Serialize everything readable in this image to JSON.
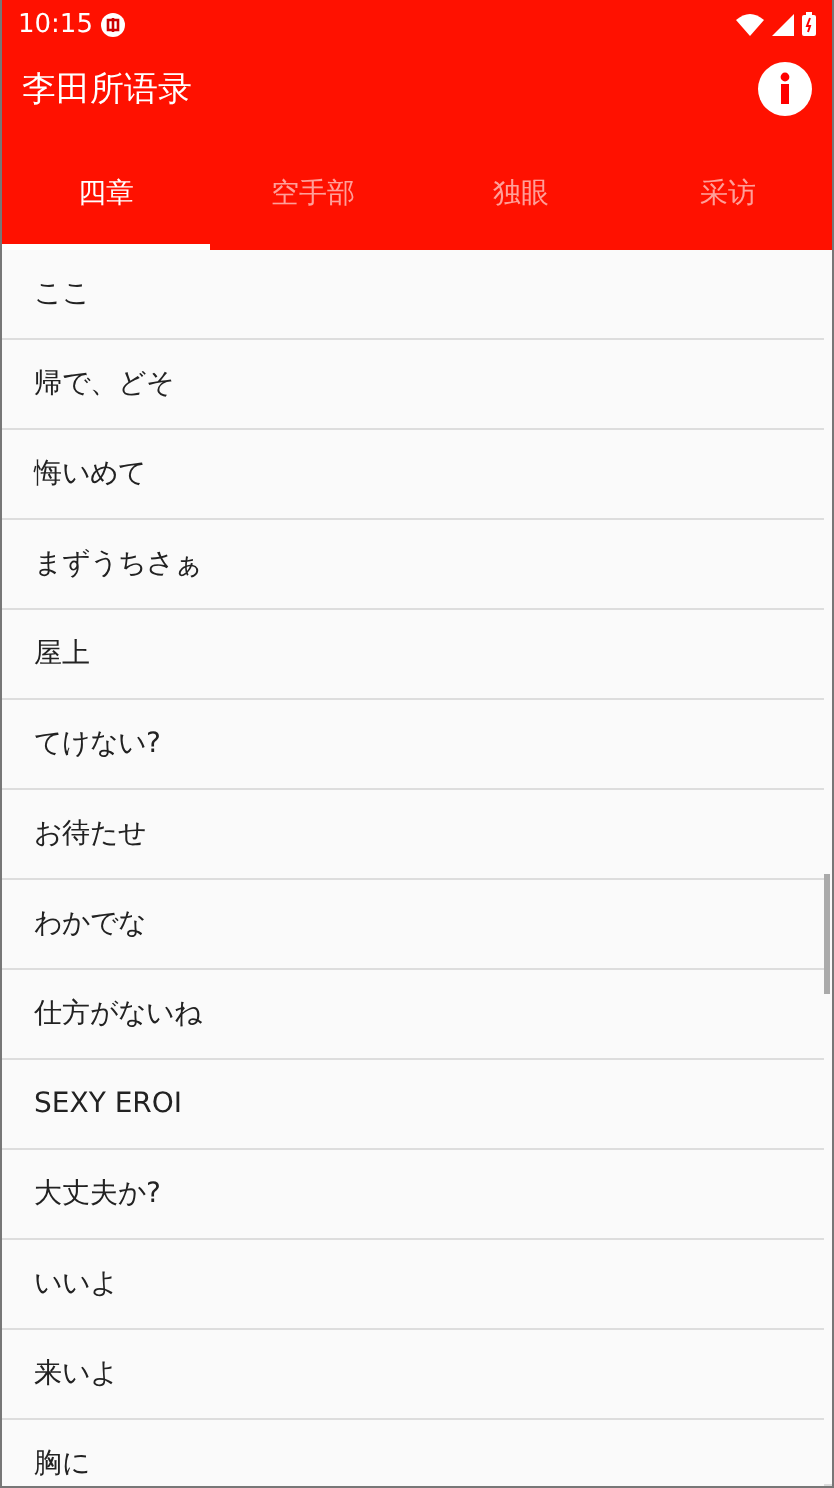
{
  "status_bar": {
    "time": "10:15"
  },
  "app_bar": {
    "title": "李田所语录"
  },
  "tabs": [
    {
      "label": "四章",
      "selected": true
    },
    {
      "label": "空手部",
      "selected": false
    },
    {
      "label": "独眼",
      "selected": false
    },
    {
      "label": "采访",
      "selected": false
    }
  ],
  "list": {
    "items": [
      "ここ",
      "帰で、どそ",
      "悔いめて",
      "まずうちさぁ",
      "屋上",
      "てけない?",
      "お待たせ",
      "わかでな",
      "仕方がないね",
      "SEXY EROI",
      "大丈夫か?",
      "いいよ",
      "来いよ",
      "胸に"
    ]
  }
}
